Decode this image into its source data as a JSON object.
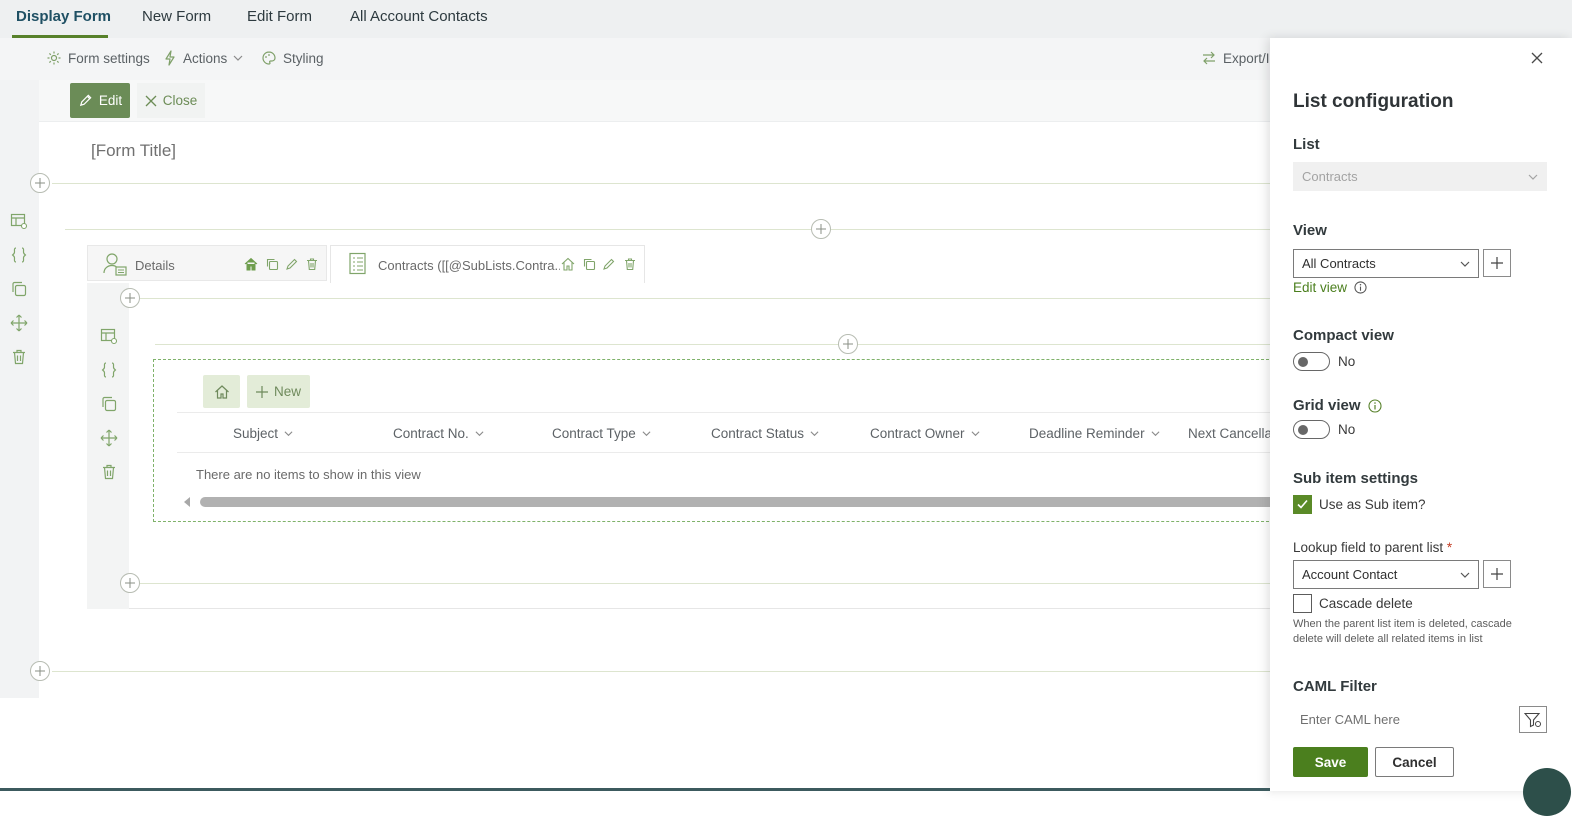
{
  "top_tabs": [
    {
      "label": "Display Form",
      "active": true
    },
    {
      "label": "New Form"
    },
    {
      "label": "Edit Form"
    },
    {
      "label": "All Account Contacts"
    }
  ],
  "command_bar": {
    "form_settings": "Form settings",
    "actions": "Actions",
    "styling": "Styling",
    "export": "Export/I"
  },
  "edit_bar": {
    "edit": "Edit",
    "close": "Close"
  },
  "form": {
    "title": "[Form Title]",
    "tabs": [
      {
        "label": "Details"
      },
      {
        "label": "Contracts ([[@SubLists.Contra..."
      }
    ],
    "list": {
      "new_label": "New",
      "columns": [
        "Subject",
        "Contract No.",
        "Contract Type",
        "Contract Status",
        "Contract Owner",
        "Deadline Reminder",
        "Next Cancella"
      ],
      "empty_message": "There are no items to show in this view"
    }
  },
  "panel": {
    "title": "List configuration",
    "list_label": "List",
    "list_value": "Contracts",
    "view_label": "View",
    "view_value": "All Contracts",
    "edit_view": "Edit view",
    "compact_label": "Compact view",
    "compact_value": "No",
    "grid_label": "Grid view",
    "grid_value": "No",
    "sub_item_label": "Sub item settings",
    "use_sub_item": "Use as Sub item?",
    "use_sub_item_checked": true,
    "lookup_label": "Lookup field to parent list",
    "required_mark": "*",
    "lookup_value": "Account Contact",
    "cascade_label": "Cascade delete",
    "cascade_checked": false,
    "cascade_help": "When the parent list item is deleted, cascade delete will delete all related items in list",
    "caml_label": "CAML Filter",
    "caml_placeholder": "Enter CAML here",
    "save": "Save",
    "cancel": "Cancel"
  },
  "colors": {
    "accent": "#57812a",
    "edit_button": "#6b8c57",
    "save_button": "#4b7f1e",
    "required": "#c23b22"
  }
}
